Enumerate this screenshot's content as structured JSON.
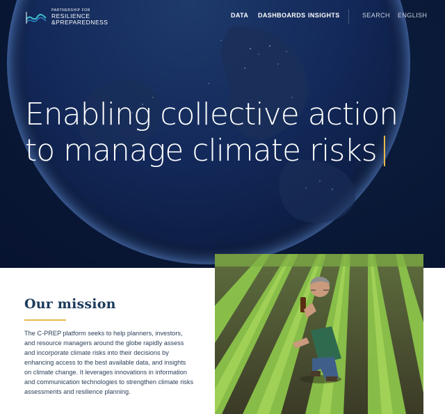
{
  "brand": {
    "tagline_small": "PARTNERSHIP FOR",
    "line1": "RESILIENCE",
    "line2": "&PREPAREDNESS"
  },
  "nav": {
    "primary": [
      "DATA",
      "DASHBOARDS",
      "INSIGHTS"
    ],
    "search": "SEARCH",
    "language": "ENGLISH"
  },
  "hero": {
    "headline_line1": "Enabling collective action",
    "headline_line2": "to manage climate risks"
  },
  "mission": {
    "title": "Our mission",
    "body": "The C-PREP platform seeks to help planners, investors, and resource managers around the globe rapidly assess and incorporate climate risks into their decisions by enhancing access to the best available data, and insights on climate change. It leverages innovations in information and communication technologies to strengthen climate risks assessments and resilience planning."
  },
  "colors": {
    "hero_bg": "#0a1a38",
    "accent": "#e9b84a",
    "title": "#1b3a5c",
    "logo_teal": "#3ec3d4"
  }
}
